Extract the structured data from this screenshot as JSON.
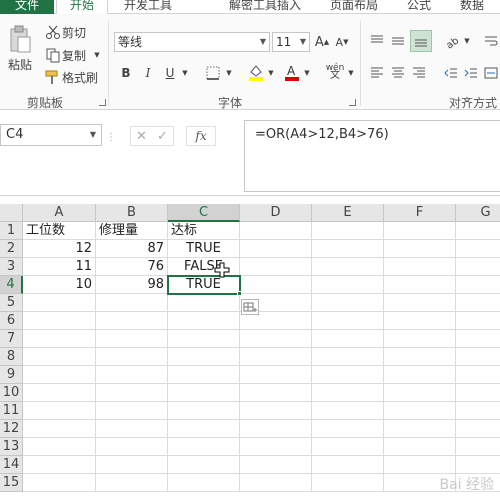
{
  "tabs": {
    "file": "文件",
    "home": "开始",
    "dev": "开发工具",
    "decrypt": "解密工具",
    "insert": "插入",
    "layout": "页面布局",
    "formulas": "公式",
    "data": "数据"
  },
  "clipboard": {
    "paste": "粘贴",
    "cut": "剪切",
    "copy": "复制",
    "format_painter": "格式刷",
    "label": "剪贴板"
  },
  "font": {
    "name": "等线",
    "size": "11",
    "bold": "B",
    "italic": "I",
    "underline": "U",
    "wen": "wén",
    "label": "字体"
  },
  "align": {
    "label": "对齐方式"
  },
  "formula_bar": {
    "name_box": "C4",
    "cancel": "✕",
    "enter": "✓",
    "fx": "fx",
    "formula": "=OR(A4>12,B4>76)"
  },
  "columns": [
    "A",
    "B",
    "C",
    "D",
    "E",
    "F",
    "G"
  ],
  "rows": [
    "1",
    "2",
    "3",
    "4",
    "5",
    "6",
    "7",
    "8",
    "9",
    "10",
    "11",
    "12",
    "13",
    "14",
    "15"
  ],
  "cells": {
    "A1": "工位数",
    "B1": "修理量",
    "C1": "达标",
    "A2": "12",
    "B2": "87",
    "C2": "TRUE",
    "A3": "11",
    "B3": "76",
    "C3": "FALSE",
    "A4": "10",
    "B4": "98",
    "C4": "TRUE"
  },
  "watermark": "Bai 经验"
}
